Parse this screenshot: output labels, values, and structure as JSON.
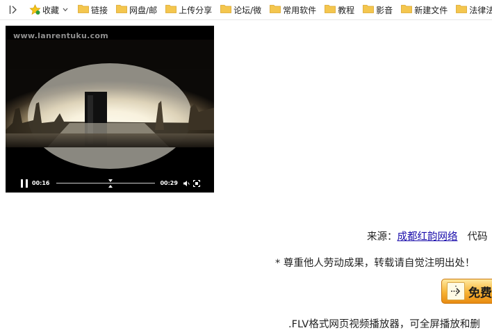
{
  "bookmarks_bar": {
    "favorites_label": "收藏",
    "folders": [
      "链接",
      "网盘/邮",
      "上传分享",
      "论坛/微",
      "常用软件",
      "教程",
      "影音",
      "新建文件",
      "法律法规"
    ]
  },
  "player": {
    "watermark": "www.lanrentuku.com",
    "current_time": "00:16",
    "total_time": "00:29",
    "progress": 0.55
  },
  "content": {
    "source_prefix": "来源：",
    "source_link": "成都红韵网络",
    "source_suffix": "代码",
    "notice": "* 尊重他人劳动成果，转载请自觉注明出处！",
    "download_label": "免费",
    "description": ".FLV格式网页视频播放器，可全屏播放和删"
  },
  "colors": {
    "link": "#1a0dab",
    "folder": "#f4c64e",
    "download_button": "#f7b334"
  }
}
